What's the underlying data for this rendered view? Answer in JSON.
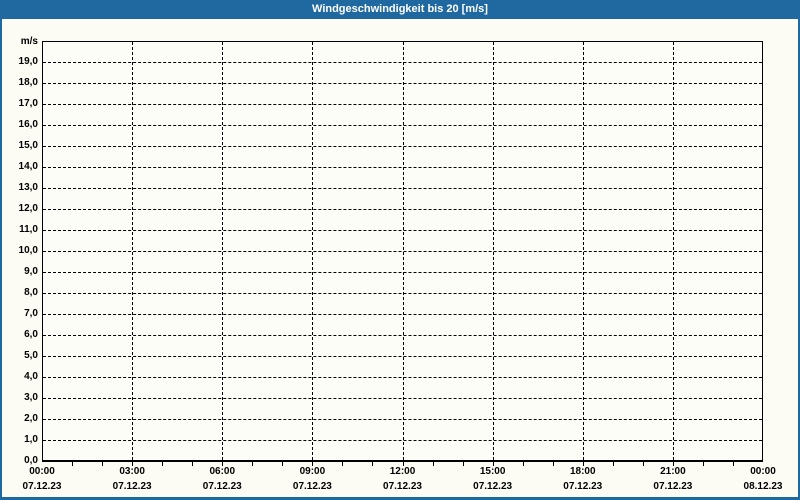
{
  "window": {
    "title": "Windgeschwindigkeit bis 20 [m/s]"
  },
  "colors": {
    "frame_blue": "#2069a0",
    "title_text": "#ffffff",
    "page_bg": "#fcfcf5",
    "plot_bg": "#fdfdf7",
    "grid": "#000000",
    "axis_text": "#000000"
  },
  "chart_data": {
    "type": "line",
    "title": "Windgeschwindigkeit bis 20 [m/s]",
    "ylabel": "m/s",
    "xlabel": "",
    "ylim": [
      0,
      20
    ],
    "y_tick_step": 1.0,
    "grid": "dashed, both axes",
    "legend": "none",
    "series": [],
    "note_no_data_plotted": true,
    "y_ticks": [
      {
        "v": 0,
        "label": "0,0"
      },
      {
        "v": 1,
        "label": "1,0"
      },
      {
        "v": 2,
        "label": "2,0"
      },
      {
        "v": 3,
        "label": "3,0"
      },
      {
        "v": 4,
        "label": "4,0"
      },
      {
        "v": 5,
        "label": "5,0"
      },
      {
        "v": 6,
        "label": "6,0"
      },
      {
        "v": 7,
        "label": "7,0"
      },
      {
        "v": 8,
        "label": "8,0"
      },
      {
        "v": 9,
        "label": "9,0"
      },
      {
        "v": 10,
        "label": "10,0"
      },
      {
        "v": 11,
        "label": "11,0"
      },
      {
        "v": 12,
        "label": "12,0"
      },
      {
        "v": 13,
        "label": "13,0"
      },
      {
        "v": 14,
        "label": "14,0"
      },
      {
        "v": 15,
        "label": "15,0"
      },
      {
        "v": 16,
        "label": "16,0"
      },
      {
        "v": 17,
        "label": "17,0"
      },
      {
        "v": 18,
        "label": "18,0"
      },
      {
        "v": 19,
        "label": "19,0"
      }
    ],
    "x_major_ticks": [
      {
        "time": "00:00",
        "date": "07.12.23"
      },
      {
        "time": "03:00",
        "date": "07.12.23"
      },
      {
        "time": "06:00",
        "date": "07.12.23"
      },
      {
        "time": "09:00",
        "date": "07.12.23"
      },
      {
        "time": "12:00",
        "date": "07.12.23"
      },
      {
        "time": "15:00",
        "date": "07.12.23"
      },
      {
        "time": "18:00",
        "date": "07.12.23"
      },
      {
        "time": "21:00",
        "date": "07.12.23"
      },
      {
        "time": "00:00",
        "date": "08.12.23"
      }
    ],
    "x_total_hours": 24,
    "x_minor_tick_every_hours": 1
  }
}
